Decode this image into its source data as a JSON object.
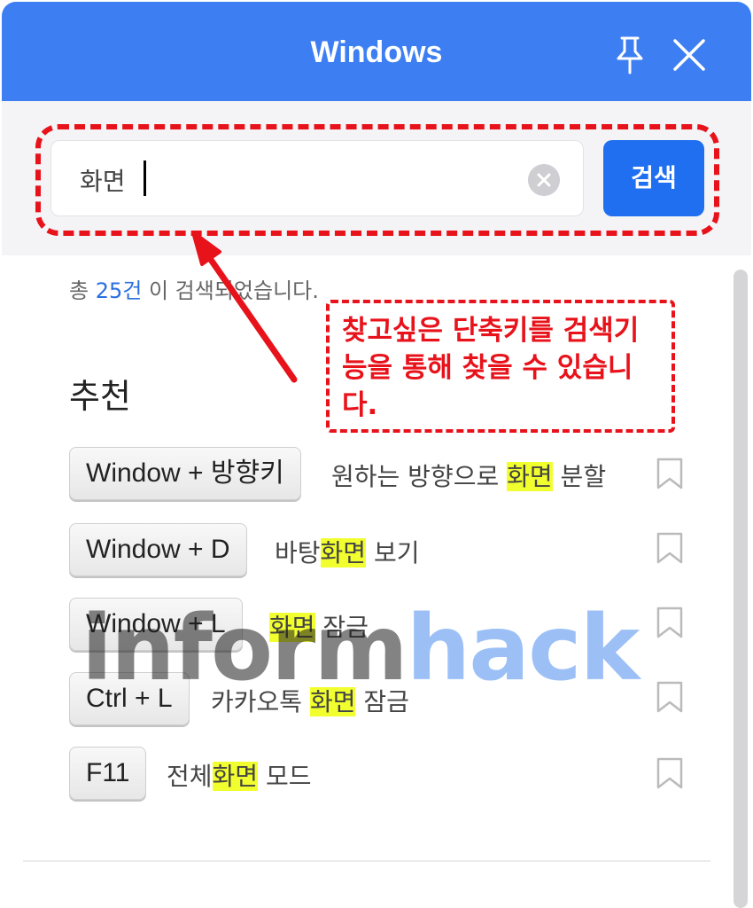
{
  "window": {
    "title": "Windows"
  },
  "search": {
    "value": "화면",
    "button_label": "검색"
  },
  "results": {
    "prefix": "총 ",
    "count": "25건",
    "suffix": " 이 검색되었습니다."
  },
  "section": {
    "title": "추천"
  },
  "shortcuts": [
    {
      "key": "Window + 방향키",
      "desc_before": "원하는 방향으로 ",
      "highlight": "화면",
      "desc_after": " 분할"
    },
    {
      "key": "Window + D",
      "desc_before": "바탕",
      "highlight": "화면",
      "desc_after": " 보기"
    },
    {
      "key": "Window + L",
      "desc_before": "",
      "highlight": "화면",
      "desc_after": " 잠금"
    },
    {
      "key": "Ctrl + L",
      "desc_before": "카카오톡 ",
      "highlight": "화면",
      "desc_after": " 잠금"
    },
    {
      "key": "F11",
      "desc_before": "전체",
      "highlight": "화면",
      "desc_after": " 모드"
    }
  ],
  "annotation": {
    "callout": "찾고싶은 단축키를 검색기능을 통해 찾을 수 있습니다."
  },
  "watermark": {
    "part1": "inform",
    "part2": "hack"
  },
  "colors": {
    "titlebar": "#3d7ff2",
    "button": "#1f6ff0",
    "annotation": "#e8121b",
    "highlight": "#f2ff2e",
    "count": "#2a6fe0"
  },
  "icons": [
    "pin-icon",
    "close-icon",
    "clear-icon",
    "bookmark-icon"
  ]
}
